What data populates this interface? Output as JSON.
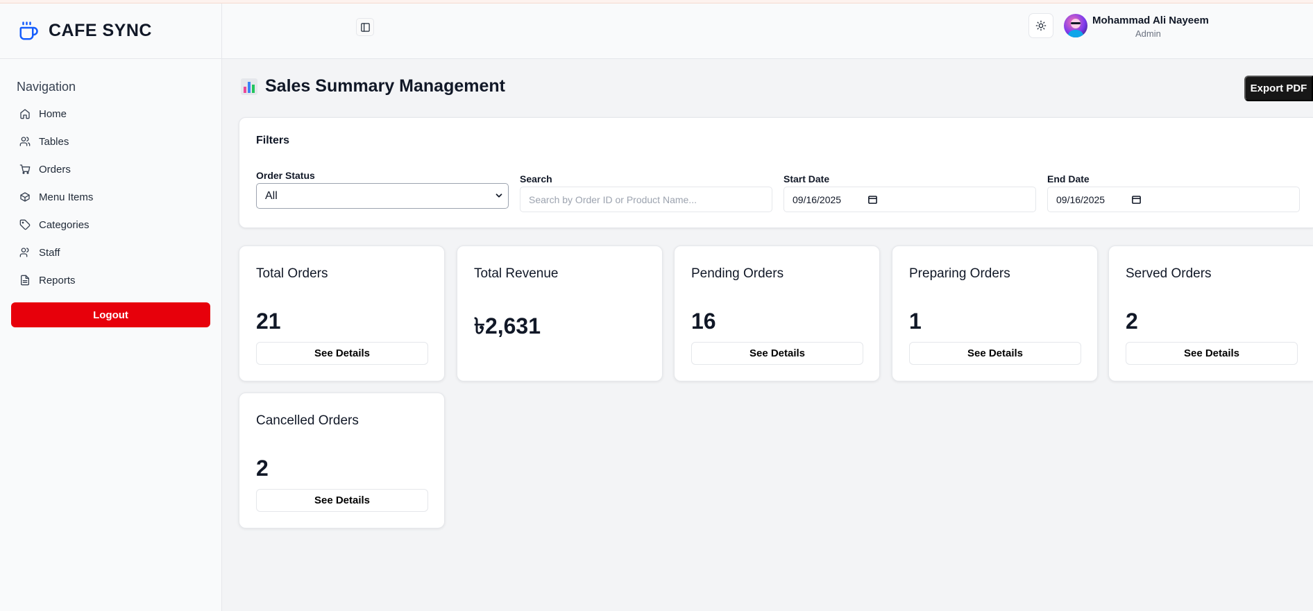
{
  "app": {
    "name": "CAFE SYNC"
  },
  "sidebar": {
    "nav_title": "Navigation",
    "items": [
      {
        "label": "Home",
        "icon": "home-icon"
      },
      {
        "label": "Tables",
        "icon": "users-icon"
      },
      {
        "label": "Orders",
        "icon": "cart-icon"
      },
      {
        "label": "Menu Items",
        "icon": "box-icon"
      },
      {
        "label": "Categories",
        "icon": "tag-icon"
      },
      {
        "label": "Staff",
        "icon": "user-icon"
      },
      {
        "label": "Reports",
        "icon": "file-icon"
      }
    ],
    "logout_label": "Logout"
  },
  "header": {
    "user_name": "Mohammad Ali Nayeem",
    "user_role": "Admin"
  },
  "page": {
    "title": "Sales Summary Management",
    "export_label": "Export PDF"
  },
  "filters": {
    "title": "Filters",
    "order_status_label": "Order Status",
    "order_status_value": "All",
    "search_label": "Search",
    "search_placeholder": "Search by Order ID or Product Name...",
    "start_date_label": "Start Date",
    "start_date_value": "09/16/2025",
    "end_date_label": "End Date",
    "end_date_value": "09/16/2025"
  },
  "cards": [
    {
      "title": "Total Orders",
      "value": "21",
      "button": "See Details"
    },
    {
      "title": "Total Revenue",
      "value": "৳2,631"
    },
    {
      "title": "Pending Orders",
      "value": "16",
      "button": "See Details"
    },
    {
      "title": "Preparing Orders",
      "value": "1",
      "button": "See Details"
    },
    {
      "title": "Served Orders",
      "value": "2",
      "button": "See Details"
    },
    {
      "title": "Cancelled Orders",
      "value": "2",
      "button": "See Details"
    }
  ],
  "colors": {
    "brand": "#155dfc",
    "logout": "#e7000b",
    "export": "#171717"
  }
}
